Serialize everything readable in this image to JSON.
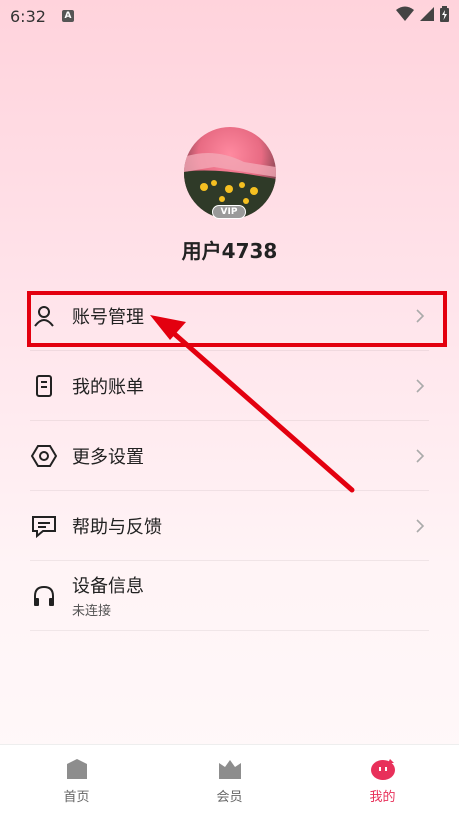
{
  "status_bar": {
    "time": "6:32",
    "notification_letter": "A"
  },
  "profile": {
    "username": "用户4738",
    "vip_label": "VIP"
  },
  "menu": [
    {
      "label": "账号管理"
    },
    {
      "label": "我的账单"
    },
    {
      "label": "更多设置"
    },
    {
      "label": "帮助与反馈"
    },
    {
      "label": "设备信息",
      "sublabel": "未连接"
    }
  ],
  "annotation": {
    "highlight_color": "#e3000f"
  },
  "tabbar": {
    "tabs": [
      {
        "label": "首页",
        "active": false
      },
      {
        "label": "会员",
        "active": false
      },
      {
        "label": "我的",
        "active": true
      }
    ],
    "active_color": "#e8305a"
  }
}
